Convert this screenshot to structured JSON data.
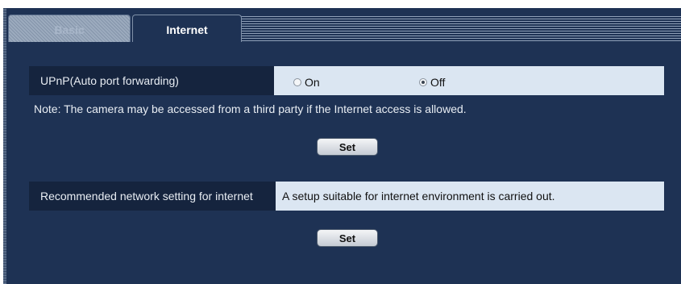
{
  "tabs": [
    {
      "label": "Basic",
      "active": false
    },
    {
      "label": "Internet",
      "active": true
    }
  ],
  "upnp": {
    "label": "UPnP(Auto port forwarding)",
    "options": [
      {
        "label": "On",
        "checked": false
      },
      {
        "label": "Off",
        "checked": true
      }
    ]
  },
  "note": "Note: The camera may be accessed from a third party if the Internet access is allowed.",
  "set_label_1": "Set",
  "recommended": {
    "label": "Recommended network setting for internet",
    "value": "A setup suitable for internet environment is carried out."
  },
  "set_label_2": "Set",
  "colors": {
    "panel_bg": "#1e3254",
    "label_bg": "#15243e",
    "value_bg": "#dbe6f2"
  }
}
